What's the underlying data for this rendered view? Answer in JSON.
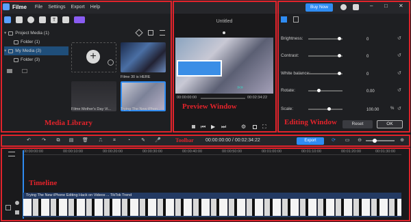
{
  "menubar": {
    "app_name": "Filme",
    "items": [
      "File",
      "Settings",
      "Export",
      "Help"
    ],
    "buy_now": "Buy Now",
    "window_controls": [
      "–",
      "□",
      "✕"
    ]
  },
  "library": {
    "tree": [
      {
        "label": "Project Media (1)",
        "selected": false,
        "indent": 0
      },
      {
        "label": "Folder (1)",
        "selected": false,
        "indent": 1
      },
      {
        "label": "My Media (3)",
        "selected": true,
        "indent": 0
      },
      {
        "label": "Folder (3)",
        "selected": false,
        "indent": 1
      }
    ],
    "thumbs": [
      {
        "caption": "Filme 30 is HERE"
      },
      {
        "caption": "Filme Mother's Day Vi..."
      },
      {
        "caption": "Trying The New iPhon..."
      }
    ],
    "label": "Media Library"
  },
  "preview": {
    "title": "Untitled",
    "time_current": "00:00:00:00",
    "time_total": "00:02:34:22",
    "label": "Preview Window"
  },
  "editing": {
    "label": "Editing Window",
    "rows": [
      {
        "label": "Brightness:",
        "value": "0",
        "level": 0.9
      },
      {
        "label": "Contrast:",
        "value": "0",
        "level": 0.9
      },
      {
        "label": "White balance:",
        "value": "0",
        "level": 0.9
      },
      {
        "label": "Rotate:",
        "value": "0.00",
        "level": 0.3
      },
      {
        "label": "Scale:",
        "value": "100.00",
        "unit": "%",
        "level": 0.6
      }
    ],
    "reset": "Reset",
    "ok": "OK"
  },
  "toolbar": {
    "label": "Toolbar",
    "timecode": "00:00:00:00 / 00:02:34:22",
    "export": "Export"
  },
  "timeline": {
    "label": "Timeline",
    "ruler": [
      "00:00:00:00",
      "00:00:10:00",
      "00:00:20:00",
      "00:00:30:00",
      "00:00:40:00",
      "00:00:50:00",
      "00:01:00:00",
      "00:01:10:00",
      "00:01:20:00",
      "00:01:30:00"
    ],
    "clip_title": "Trying The New iPhone Editing Hack on Videos ... TikTok Trend"
  },
  "colors": {
    "accent": "#2f8cf2",
    "annotation": "#e3232b",
    "selection": "#1f4e7a"
  }
}
